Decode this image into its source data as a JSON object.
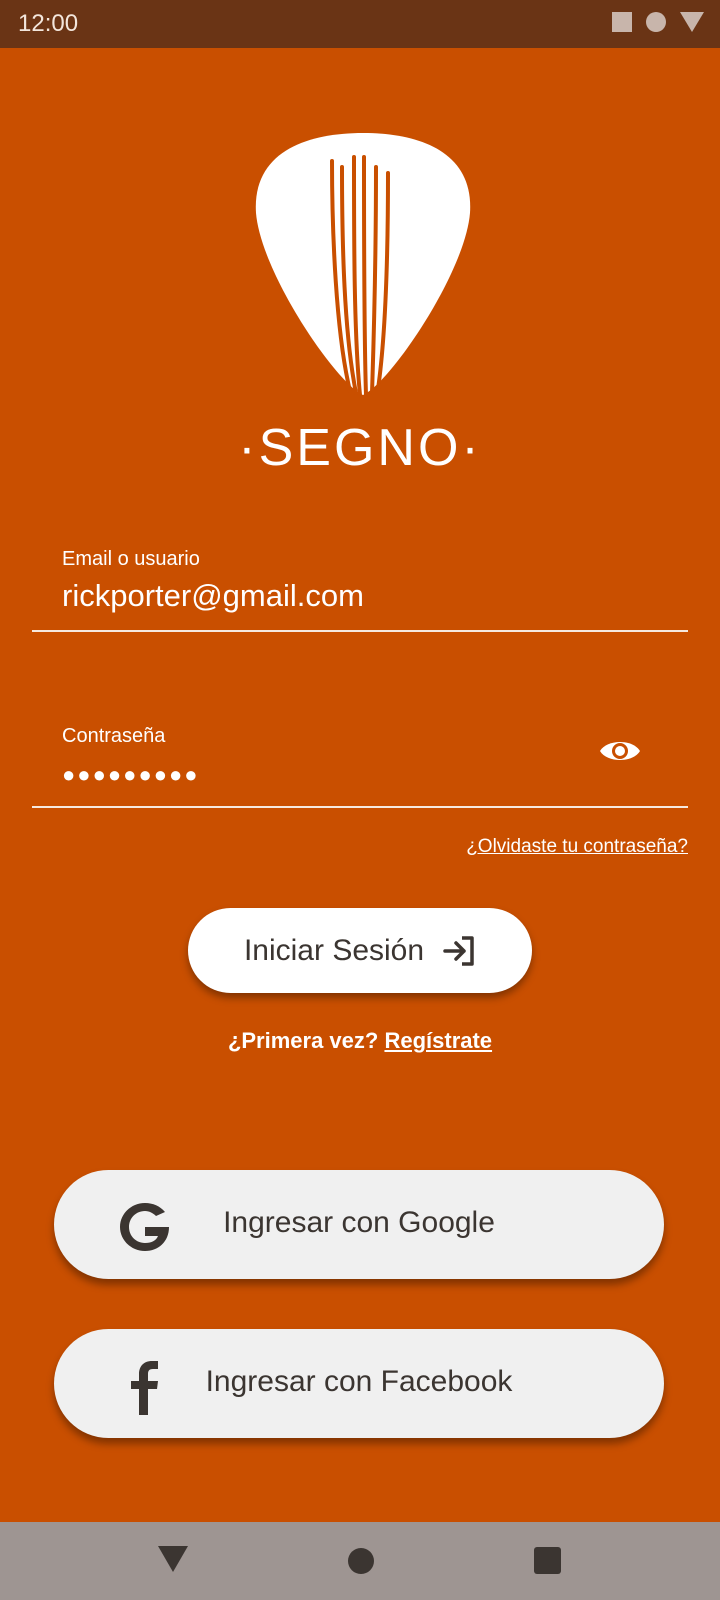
{
  "status_bar": {
    "time": "12:00"
  },
  "brand": {
    "name": "·SEGNO·"
  },
  "email_field": {
    "label": "Email o usuario",
    "value": "rickporter@gmail.com"
  },
  "password_field": {
    "label": "Contraseña",
    "value": "●●●●●●●●●"
  },
  "forgot_link": "¿Olvidaste tu contraseña?",
  "login_button": {
    "label": "Iniciar Sesión"
  },
  "first_time": {
    "prompt": "¿Primera vez? ",
    "register_link": "Regístrate"
  },
  "social": {
    "google_label": "Ingresar con Google",
    "facebook_label": "Ingresar con Facebook"
  },
  "colors": {
    "background": "#C94F00",
    "status_bar": "#6A3415",
    "text_dark": "#3b3531",
    "social_button": "#f0f0f0",
    "nav_bar": "#9E9592"
  },
  "icons": {
    "eye": "eye-icon",
    "login": "login-arrow-icon",
    "google": "google-icon",
    "facebook": "facebook-icon"
  }
}
